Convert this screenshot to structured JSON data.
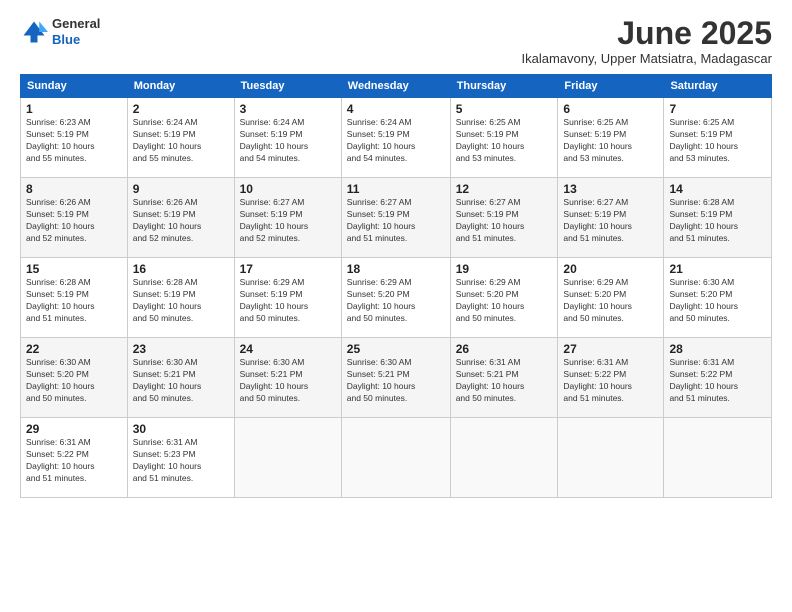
{
  "logo": {
    "general": "General",
    "blue": "Blue"
  },
  "title": "June 2025",
  "subtitle": "Ikalamavony, Upper Matsiatra, Madagascar",
  "days_header": [
    "Sunday",
    "Monday",
    "Tuesday",
    "Wednesday",
    "Thursday",
    "Friday",
    "Saturday"
  ],
  "weeks": [
    [
      {
        "day": "1",
        "info": "Sunrise: 6:23 AM\nSunset: 5:19 PM\nDaylight: 10 hours\nand 55 minutes."
      },
      {
        "day": "2",
        "info": "Sunrise: 6:24 AM\nSunset: 5:19 PM\nDaylight: 10 hours\nand 55 minutes."
      },
      {
        "day": "3",
        "info": "Sunrise: 6:24 AM\nSunset: 5:19 PM\nDaylight: 10 hours\nand 54 minutes."
      },
      {
        "day": "4",
        "info": "Sunrise: 6:24 AM\nSunset: 5:19 PM\nDaylight: 10 hours\nand 54 minutes."
      },
      {
        "day": "5",
        "info": "Sunrise: 6:25 AM\nSunset: 5:19 PM\nDaylight: 10 hours\nand 53 minutes."
      },
      {
        "day": "6",
        "info": "Sunrise: 6:25 AM\nSunset: 5:19 PM\nDaylight: 10 hours\nand 53 minutes."
      },
      {
        "day": "7",
        "info": "Sunrise: 6:25 AM\nSunset: 5:19 PM\nDaylight: 10 hours\nand 53 minutes."
      }
    ],
    [
      {
        "day": "8",
        "info": "Sunrise: 6:26 AM\nSunset: 5:19 PM\nDaylight: 10 hours\nand 52 minutes."
      },
      {
        "day": "9",
        "info": "Sunrise: 6:26 AM\nSunset: 5:19 PM\nDaylight: 10 hours\nand 52 minutes."
      },
      {
        "day": "10",
        "info": "Sunrise: 6:27 AM\nSunset: 5:19 PM\nDaylight: 10 hours\nand 52 minutes."
      },
      {
        "day": "11",
        "info": "Sunrise: 6:27 AM\nSunset: 5:19 PM\nDaylight: 10 hours\nand 51 minutes."
      },
      {
        "day": "12",
        "info": "Sunrise: 6:27 AM\nSunset: 5:19 PM\nDaylight: 10 hours\nand 51 minutes."
      },
      {
        "day": "13",
        "info": "Sunrise: 6:27 AM\nSunset: 5:19 PM\nDaylight: 10 hours\nand 51 minutes."
      },
      {
        "day": "14",
        "info": "Sunrise: 6:28 AM\nSunset: 5:19 PM\nDaylight: 10 hours\nand 51 minutes."
      }
    ],
    [
      {
        "day": "15",
        "info": "Sunrise: 6:28 AM\nSunset: 5:19 PM\nDaylight: 10 hours\nand 51 minutes."
      },
      {
        "day": "16",
        "info": "Sunrise: 6:28 AM\nSunset: 5:19 PM\nDaylight: 10 hours\nand 50 minutes."
      },
      {
        "day": "17",
        "info": "Sunrise: 6:29 AM\nSunset: 5:19 PM\nDaylight: 10 hours\nand 50 minutes."
      },
      {
        "day": "18",
        "info": "Sunrise: 6:29 AM\nSunset: 5:20 PM\nDaylight: 10 hours\nand 50 minutes."
      },
      {
        "day": "19",
        "info": "Sunrise: 6:29 AM\nSunset: 5:20 PM\nDaylight: 10 hours\nand 50 minutes."
      },
      {
        "day": "20",
        "info": "Sunrise: 6:29 AM\nSunset: 5:20 PM\nDaylight: 10 hours\nand 50 minutes."
      },
      {
        "day": "21",
        "info": "Sunrise: 6:30 AM\nSunset: 5:20 PM\nDaylight: 10 hours\nand 50 minutes."
      }
    ],
    [
      {
        "day": "22",
        "info": "Sunrise: 6:30 AM\nSunset: 5:20 PM\nDaylight: 10 hours\nand 50 minutes."
      },
      {
        "day": "23",
        "info": "Sunrise: 6:30 AM\nSunset: 5:21 PM\nDaylight: 10 hours\nand 50 minutes."
      },
      {
        "day": "24",
        "info": "Sunrise: 6:30 AM\nSunset: 5:21 PM\nDaylight: 10 hours\nand 50 minutes."
      },
      {
        "day": "25",
        "info": "Sunrise: 6:30 AM\nSunset: 5:21 PM\nDaylight: 10 hours\nand 50 minutes."
      },
      {
        "day": "26",
        "info": "Sunrise: 6:31 AM\nSunset: 5:21 PM\nDaylight: 10 hours\nand 50 minutes."
      },
      {
        "day": "27",
        "info": "Sunrise: 6:31 AM\nSunset: 5:22 PM\nDaylight: 10 hours\nand 51 minutes."
      },
      {
        "day": "28",
        "info": "Sunrise: 6:31 AM\nSunset: 5:22 PM\nDaylight: 10 hours\nand 51 minutes."
      }
    ],
    [
      {
        "day": "29",
        "info": "Sunrise: 6:31 AM\nSunset: 5:22 PM\nDaylight: 10 hours\nand 51 minutes."
      },
      {
        "day": "30",
        "info": "Sunrise: 6:31 AM\nSunset: 5:23 PM\nDaylight: 10 hours\nand 51 minutes."
      },
      {
        "day": "",
        "info": ""
      },
      {
        "day": "",
        "info": ""
      },
      {
        "day": "",
        "info": ""
      },
      {
        "day": "",
        "info": ""
      },
      {
        "day": "",
        "info": ""
      }
    ]
  ]
}
